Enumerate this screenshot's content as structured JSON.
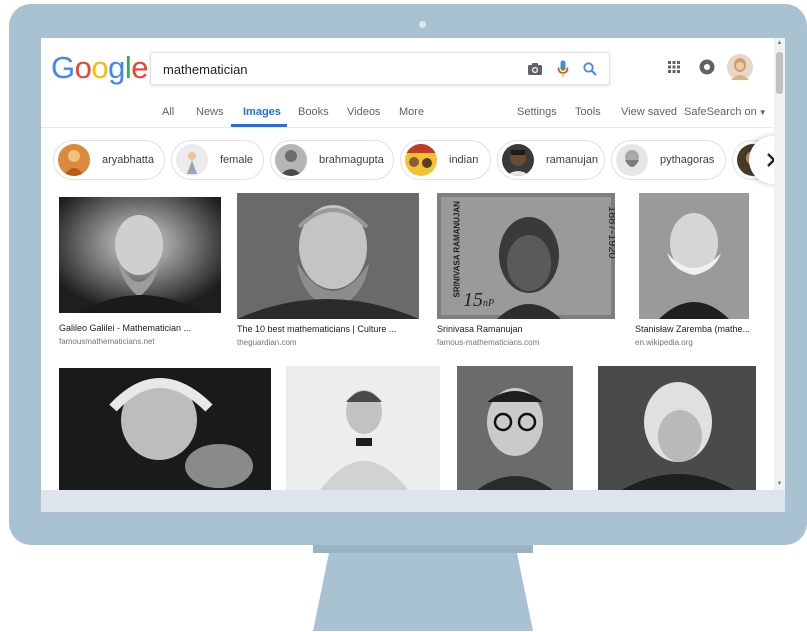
{
  "search": {
    "query": "mathematician"
  },
  "logo": {
    "letters": [
      "G",
      "o",
      "o",
      "g",
      "l",
      "e"
    ],
    "colors": [
      "#4285f4",
      "#ea4335",
      "#fbbc05",
      "#4285f4",
      "#34a853",
      "#ea4335"
    ]
  },
  "tabs": {
    "all": "All",
    "news": "News",
    "images": "Images",
    "books": "Books",
    "videos": "Videos",
    "more": "More",
    "settings": "Settings",
    "tools": "Tools",
    "view_saved": "View saved",
    "safesearch": "SafeSearch on"
  },
  "chips": [
    {
      "label": "aryabhatta"
    },
    {
      "label": "female"
    },
    {
      "label": "brahmagupta"
    },
    {
      "label": "indian"
    },
    {
      "label": "ramanujan"
    },
    {
      "label": "pythagoras"
    }
  ],
  "results": [
    {
      "title": "Galileo Galilei - Mathematician ...",
      "source": "famousmathematicians.net"
    },
    {
      "title": "The 10 best mathematicians | Culture ...",
      "source": "theguardian.com"
    },
    {
      "title": "Srinivasa Ramanujan",
      "source": "famous-mathematicians.com"
    },
    {
      "title": "Stanisław Zaremba (mathe...",
      "source": "en.wikipedia.org"
    }
  ],
  "stamp": {
    "name": "SRINIVASA RAMANUJAN",
    "years": "1887-1920",
    "value": "15",
    "unit": "nP"
  },
  "colors": {
    "accent": "#1a73e8",
    "monitor": "#a9c2d2"
  }
}
